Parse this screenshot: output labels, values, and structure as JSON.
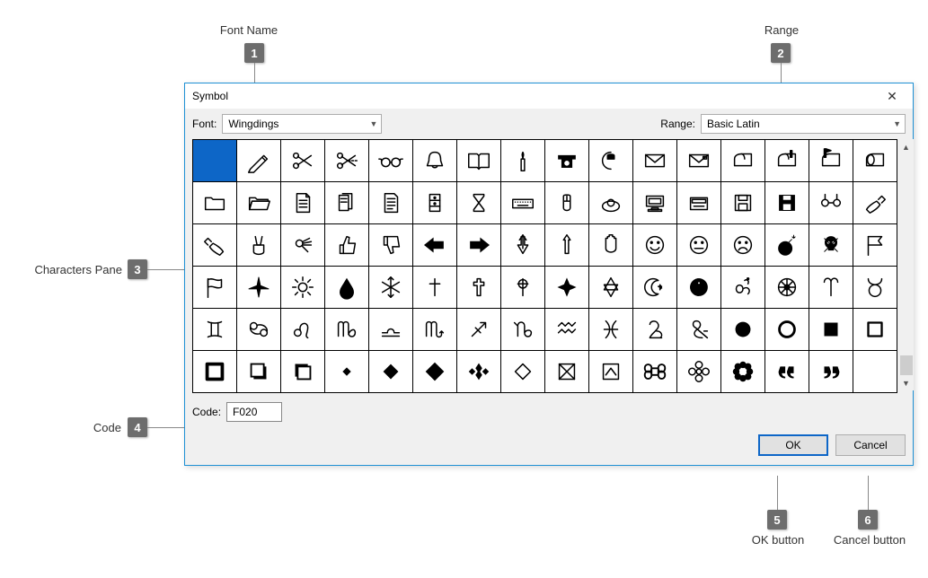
{
  "annotations": {
    "a1": {
      "label": "Font Name",
      "num": "1"
    },
    "a2": {
      "label": "Range",
      "num": "2"
    },
    "a3": {
      "label": "Characters Pane",
      "num": "3"
    },
    "a4": {
      "label": "Code",
      "num": "4"
    },
    "a5": {
      "label": "OK button",
      "num": "5"
    },
    "a6": {
      "label": "Cancel button",
      "num": "6"
    }
  },
  "dialog": {
    "title": "Symbol",
    "font_label": "Font:",
    "font_value": "Wingdings",
    "range_label": "Range:",
    "range_value": "Basic Latin",
    "code_label": "Code:",
    "code_value": "F020",
    "ok_label": "OK",
    "cancel_label": "Cancel"
  },
  "chars": [
    "blank",
    "pencil",
    "scissors",
    "scissors-cut",
    "glasses",
    "bell",
    "book-open",
    "candle",
    "telephone",
    "telephone-receiver",
    "envelope",
    "envelope-stamp",
    "mailbox-1",
    "mailbox-2",
    "mailbox-flag",
    "mailbox-open",
    "folder",
    "folder-open",
    "document",
    "documents",
    "clipboard",
    "file-cabinet",
    "hourglass",
    "keyboard",
    "mouse",
    "trackball",
    "computer",
    "disk-drive",
    "floppy-1",
    "floppy-2",
    "scissors-tape",
    "writing-hand",
    "writing-hand-2",
    "victory-hand",
    "ok-hand",
    "thumbs-up",
    "thumbs-down",
    "point-left",
    "point-right",
    "point-up",
    "point-up-2",
    "hand",
    "smile",
    "neutral-face",
    "frown",
    "bomb",
    "skull",
    "flag",
    "pennant",
    "airplane",
    "sun",
    "drop",
    "snowflake",
    "cross-latin",
    "cross-outline",
    "cross-celtic",
    "cross-maltese",
    "star-of-david",
    "star-crescent",
    "yin-yang",
    "om",
    "wheel",
    "aries",
    "taurus",
    "gemini",
    "cancer",
    "leo",
    "virgo",
    "libra",
    "scorpio",
    "sagittarius",
    "capricorn",
    "aquarius",
    "pisces",
    "et",
    "ampersand",
    "circle-filled",
    "circle-outline",
    "square-filled",
    "square-outline",
    "square-outline-2",
    "shadow-sq-br",
    "shadow-sq-tl",
    "diamond-small",
    "diamond-filled",
    "diamond-large",
    "diamond-4",
    "diamond-outline",
    "box-x",
    "box-caret",
    "command",
    "flower-outline",
    "flower-filled",
    "quote-open",
    "quote-close",
    "blank2"
  ]
}
